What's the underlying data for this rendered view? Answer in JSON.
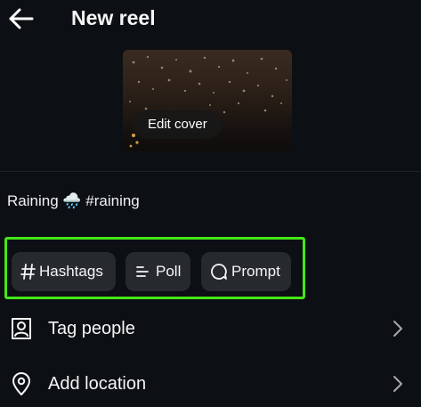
{
  "header": {
    "title": "New reel",
    "back_icon": "arrow-left-icon"
  },
  "cover": {
    "edit_label": "Edit cover"
  },
  "caption": {
    "text": "Raining 🌧️ #raining"
  },
  "chips": [
    {
      "label": "Hashtags",
      "icon": "hash-icon"
    },
    {
      "label": "Poll",
      "icon": "poll-icon"
    },
    {
      "label": "Prompt",
      "icon": "prompt-bubble-icon"
    }
  ],
  "options": [
    {
      "label": "Tag people",
      "icon": "tag-person-icon"
    },
    {
      "label": "Add location",
      "icon": "location-pin-icon"
    }
  ],
  "colors": {
    "background": "#0c1014",
    "highlight": "#45e617",
    "chip_bg": "#26292e"
  }
}
